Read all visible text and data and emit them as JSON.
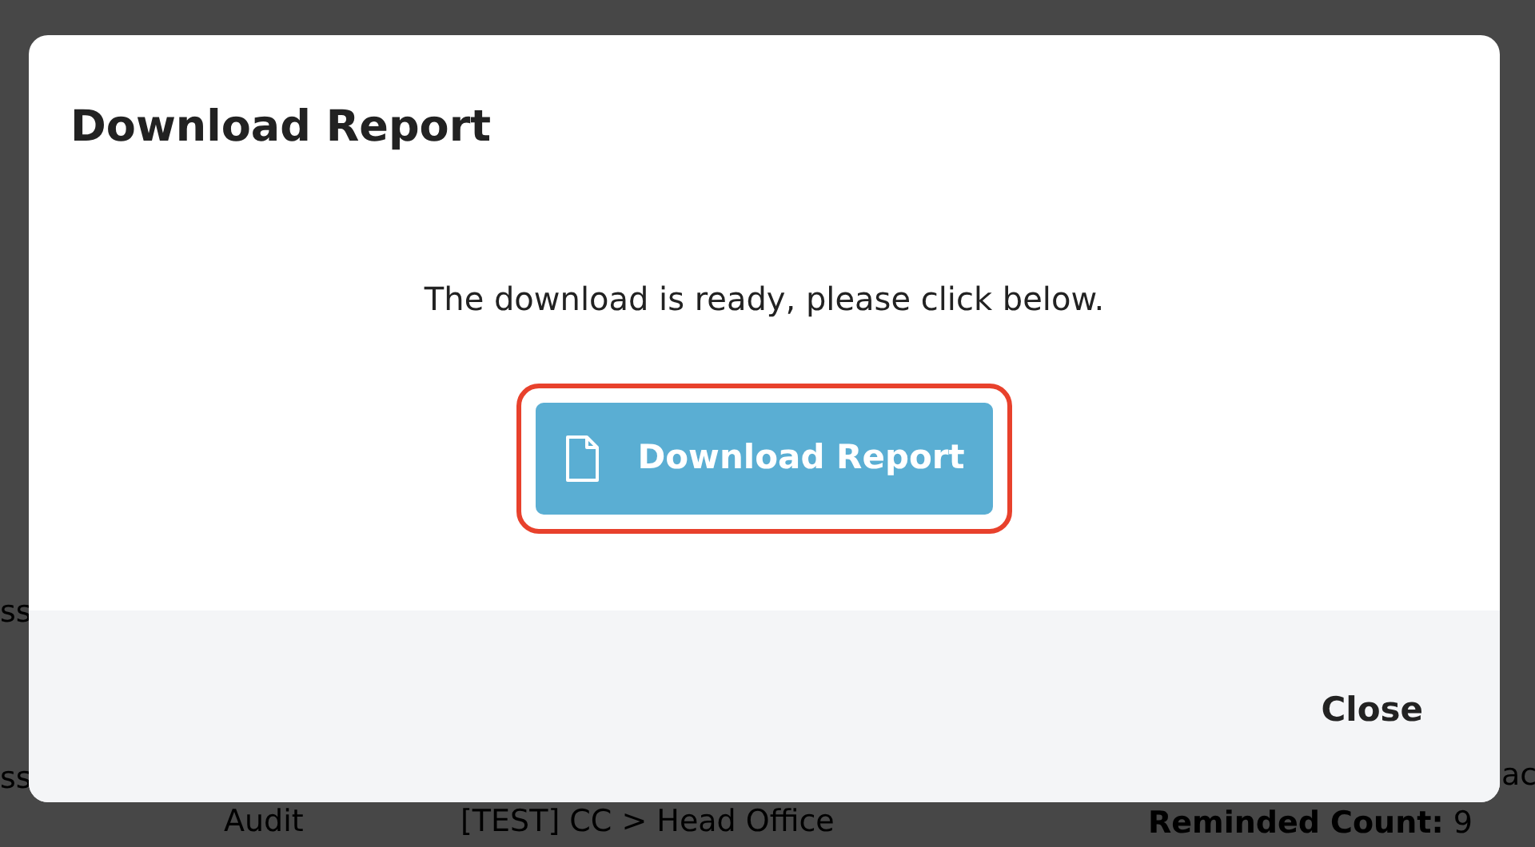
{
  "background": {
    "fragments": [
      {
        "kind": "plain",
        "text": "ss"
      },
      {
        "kind": "plain",
        "text": "ss"
      },
      {
        "kind": "plain",
        "text": "Audit"
      },
      {
        "kind": "plain",
        "text": "[TEST] CC > Head Office"
      },
      {
        "kind": "plain",
        "text": "ac"
      },
      {
        "kind": "labelled",
        "label": "Reminded Count:",
        "text": "9"
      }
    ]
  },
  "modal": {
    "title": "Download Report",
    "message": "The download is ready, please click below.",
    "download_button": {
      "label": "Download Report",
      "highlighted": true
    },
    "footer_button": {
      "label": "Close"
    }
  }
}
